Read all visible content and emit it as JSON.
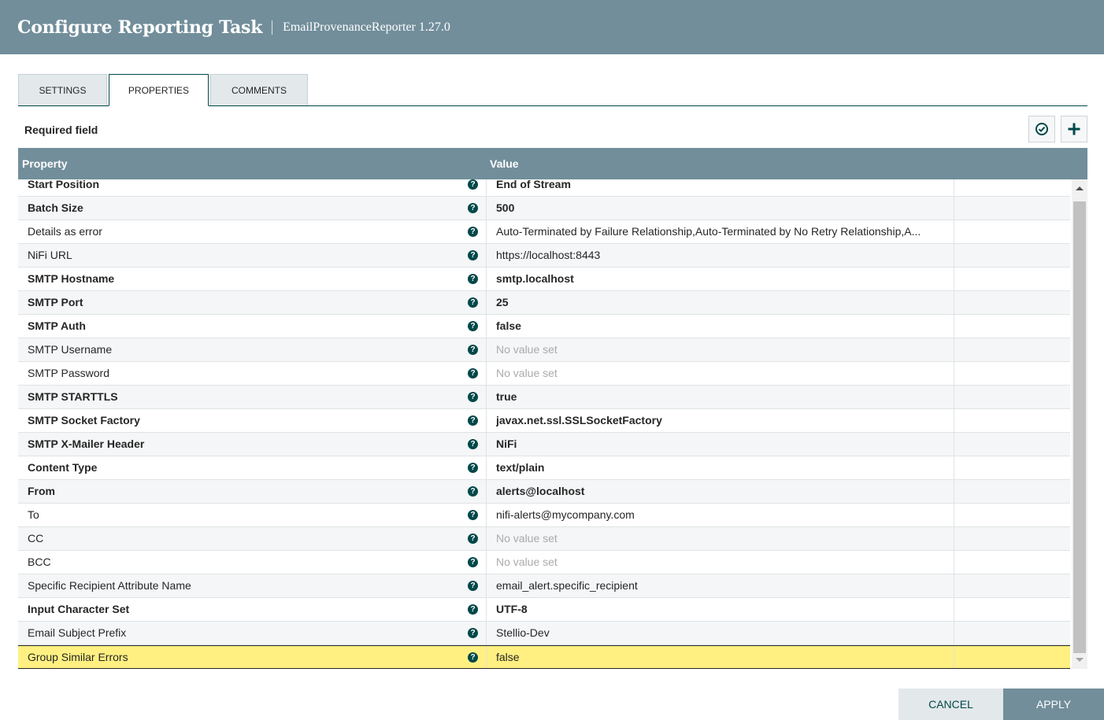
{
  "header": {
    "title": "Configure Reporting Task",
    "subtitle": "EmailProvenanceReporter 1.27.0"
  },
  "tabs": [
    {
      "label": "SETTINGS"
    },
    {
      "label": "PROPERTIES"
    },
    {
      "label": "COMMENTS"
    }
  ],
  "required_label": "Required field",
  "table": {
    "headers": {
      "property": "Property",
      "value": "Value"
    },
    "rows": [
      {
        "name": "Start Position",
        "value": "End of Stream",
        "required": true
      },
      {
        "name": "Batch Size",
        "value": "500",
        "required": true
      },
      {
        "name": "Details as error",
        "value": "Auto-Terminated by Failure Relationship,Auto-Terminated by No Retry Relationship,A...",
        "required": false
      },
      {
        "name": "NiFi URL",
        "value": "https://localhost:8443",
        "required": false
      },
      {
        "name": "SMTP Hostname",
        "value": "smtp.localhost",
        "required": true
      },
      {
        "name": "SMTP Port",
        "value": "25",
        "required": true
      },
      {
        "name": "SMTP Auth",
        "value": "false",
        "required": true
      },
      {
        "name": "SMTP Username",
        "value": "No value set",
        "required": false,
        "unset": true
      },
      {
        "name": "SMTP Password",
        "value": "No value set",
        "required": false,
        "unset": true
      },
      {
        "name": "SMTP STARTTLS",
        "value": "true",
        "required": true
      },
      {
        "name": "SMTP Socket Factory",
        "value": "javax.net.ssl.SSLSocketFactory",
        "required": true
      },
      {
        "name": "SMTP X-Mailer Header",
        "value": "NiFi",
        "required": true
      },
      {
        "name": "Content Type",
        "value": "text/plain",
        "required": true
      },
      {
        "name": "From",
        "value": "alerts@localhost",
        "required": true
      },
      {
        "name": "To",
        "value": "nifi-alerts@mycompany.com",
        "required": false
      },
      {
        "name": "CC",
        "value": "No value set",
        "required": false,
        "unset": true
      },
      {
        "name": "BCC",
        "value": "No value set",
        "required": false,
        "unset": true
      },
      {
        "name": "Specific Recipient Attribute Name",
        "value": "email_alert.specific_recipient",
        "required": false
      },
      {
        "name": "Input Character Set",
        "value": "UTF-8",
        "required": true
      },
      {
        "name": "Email Subject Prefix",
        "value": "Stellio-Dev",
        "required": false
      },
      {
        "name": "Group Similar Errors",
        "value": "false",
        "required": false,
        "selected": true
      }
    ]
  },
  "buttons": {
    "cancel": "CANCEL",
    "apply": "APPLY"
  },
  "icons": {
    "verify": "check-circle-icon",
    "add": "plus-icon",
    "help": "question-circle-icon"
  },
  "colors": {
    "header": "#728e9b",
    "accent": "#004849",
    "selected_row": "#fff081"
  }
}
